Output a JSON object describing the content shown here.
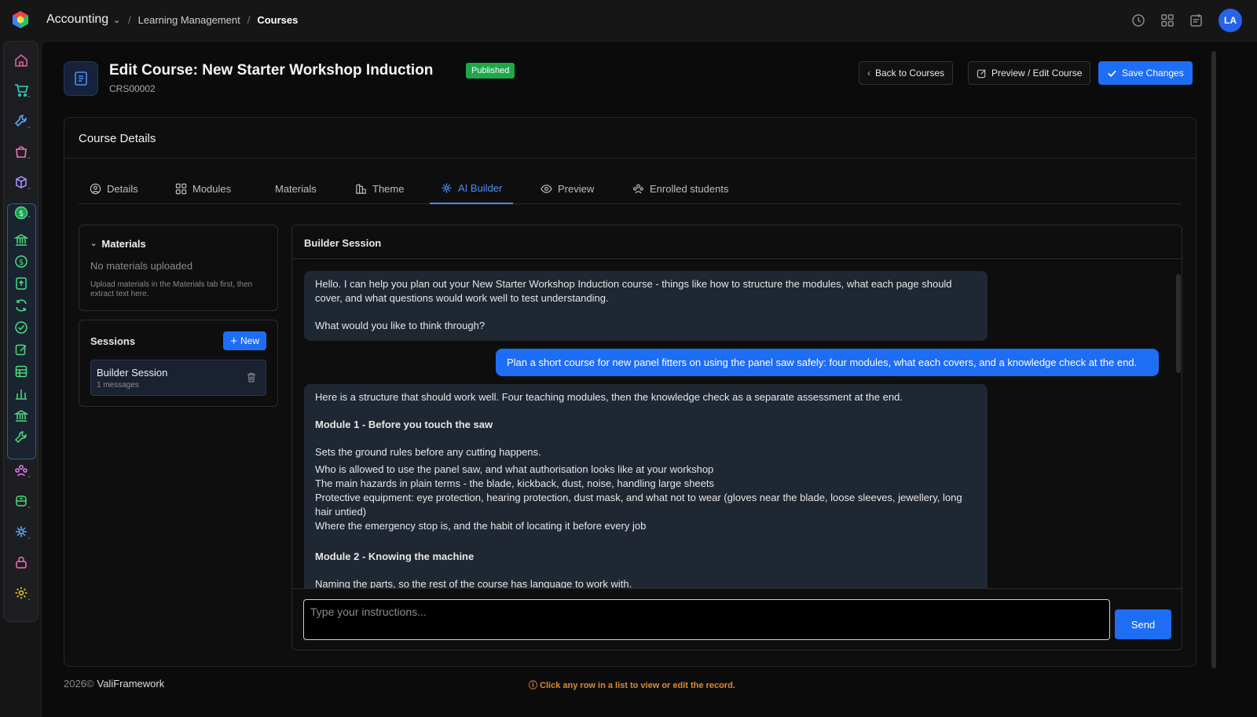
{
  "app": {
    "name": "Accounting"
  },
  "breadcrumb": [
    "Learning Management",
    "Courses"
  ],
  "user": {
    "initials": "LA"
  },
  "header": {
    "title": "Edit Course: New Starter Workshop Induction",
    "status": "Published",
    "code": "CRS00002",
    "back_label": "Back to Courses",
    "preview_label": "Preview / Edit Course",
    "save_label": "Save Changes"
  },
  "card": {
    "title": "Course Details"
  },
  "tabs": [
    {
      "label": "Details",
      "icon": "user-circle-icon"
    },
    {
      "label": "Modules",
      "icon": "grid-icon"
    },
    {
      "label": "Materials",
      "icon": ""
    },
    {
      "label": "Theme",
      "icon": "theme-icon"
    },
    {
      "label": "AI Builder",
      "icon": "ai-icon",
      "active": true
    },
    {
      "label": "Preview",
      "icon": "eye-icon"
    },
    {
      "label": "Enrolled students",
      "icon": "users-icon"
    }
  ],
  "materials": {
    "title": "Materials",
    "empty": "No materials uploaded",
    "hint": "Upload materials in the Materials tab first, then extract text here."
  },
  "sessions": {
    "title": "Sessions",
    "new_label": "New",
    "items": [
      {
        "name": "Builder Session",
        "meta": "1 messages"
      }
    ]
  },
  "chat": {
    "title": "Builder Session",
    "messages": {
      "m1_p1": "Hello. I can help you plan out your New Starter Workshop Induction course - things like how to structure the modules, what each page should cover, and what questions would work well to test understanding.",
      "m1_p2": "What would you like to think through?",
      "m2": "Plan a short course for new panel fitters on using the panel saw safely: four modules, what each covers, and a knowledge check at the end.",
      "m3_intro": "Here is a structure that should work well. Four teaching modules, then the knowledge check as a separate assessment at the end.",
      "m3_h1": "Module 1 - Before you touch the saw",
      "m3_h1_sub": "Sets the ground rules before any cutting happens.",
      "m3_l1": "Who is allowed to use the panel saw, and what authorisation looks like at your workshop",
      "m3_l2": "The main hazards in plain terms - the blade, kickback, dust, noise, handling large sheets",
      "m3_l3": "Protective equipment: eye protection, hearing protection, dust mask, and what not to wear (gloves near the blade, loose sleeves, jewellery, long hair untied)",
      "m3_l4": "Where the emergency stop is, and the habit of locating it before every job",
      "m3_h2": "Module 2 - Knowing the machine",
      "m3_h2_sub": "Naming the parts, so the rest of the course has language to work with."
    },
    "input_placeholder": "Type your instructions...",
    "send_label": "Send"
  },
  "footer": {
    "year": "2026©",
    "brand": "ValiFramework",
    "note": "ⓘ Click any row in a list to view or edit the record."
  },
  "colors": {
    "accent": "#1d6ef5",
    "published": "#1ea84a",
    "footer_note": "#e08a2c"
  }
}
